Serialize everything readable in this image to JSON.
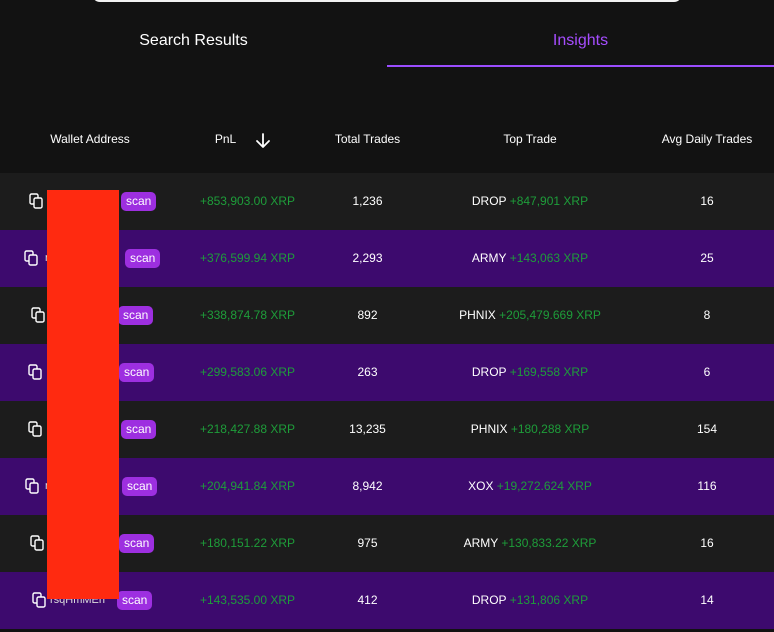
{
  "tabs": [
    {
      "label": "Search Results",
      "active": false
    },
    {
      "label": "Insights",
      "active": true
    }
  ],
  "colors": {
    "accent": "#9b4dff",
    "gain": "#1e9d3a",
    "row_alt": "#3d0a6e",
    "scan_button": "#9d2fe0",
    "redaction": "#ff2a10"
  },
  "table": {
    "headers": {
      "wallet": "Wallet Address",
      "pnl": "PnL",
      "total_trades": "Total Trades",
      "top_trade": "Top Trade",
      "avg_daily": "Avg Daily Trades"
    },
    "sort": {
      "column": "PnL",
      "direction": "descending",
      "icon": "arrow-down-icon"
    },
    "rows": [
      {
        "wallet_visible": "",
        "scan": "scan",
        "pnl": "+853,903.00 XRP",
        "total_trades": "1,236",
        "top_token": "DROP",
        "top_gain": "+847,901 XRP",
        "avg_daily": "16"
      },
      {
        "wallet_visible": "r",
        "scan": "scan",
        "pnl": "+376,599.94 XRP",
        "total_trades": "2,293",
        "top_token": "ARMY",
        "top_gain": "+143,063 XRP",
        "avg_daily": "25"
      },
      {
        "wallet_visible": "",
        "scan": "scan",
        "pnl": "+338,874.78 XRP",
        "total_trades": "892",
        "top_token": "PHNIX",
        "top_gain": "+205,479.669 XRP",
        "avg_daily": "8"
      },
      {
        "wallet_visible": "",
        "scan": "scan",
        "pnl": "+299,583.06 XRP",
        "total_trades": "263",
        "top_token": "DROP",
        "top_gain": "+169,558 XRP",
        "avg_daily": "6"
      },
      {
        "wallet_visible": "",
        "scan": "scan",
        "pnl": "+218,427.88 XRP",
        "total_trades": "13,235",
        "top_token": "PHNIX",
        "top_gain": "+180,288 XRP",
        "avg_daily": "154"
      },
      {
        "wallet_visible": "r",
        "scan": "scan",
        "pnl": "+204,941.84 XRP",
        "total_trades": "8,942",
        "top_token": "XOX",
        "top_gain": "+19,272.624 XRP",
        "avg_daily": "116"
      },
      {
        "wallet_visible": "",
        "scan": "scan",
        "pnl": "+180,151.22 XRP",
        "total_trades": "975",
        "top_token": "ARMY",
        "top_gain": "+130,833.22 XRP",
        "avg_daily": "16"
      },
      {
        "wallet_visible": "rsqHmMEh",
        "scan": "scan",
        "pnl": "+143,535.00 XRP",
        "total_trades": "412",
        "top_token": "DROP",
        "top_gain": "+131,806 XRP",
        "avg_daily": "14"
      }
    ]
  }
}
